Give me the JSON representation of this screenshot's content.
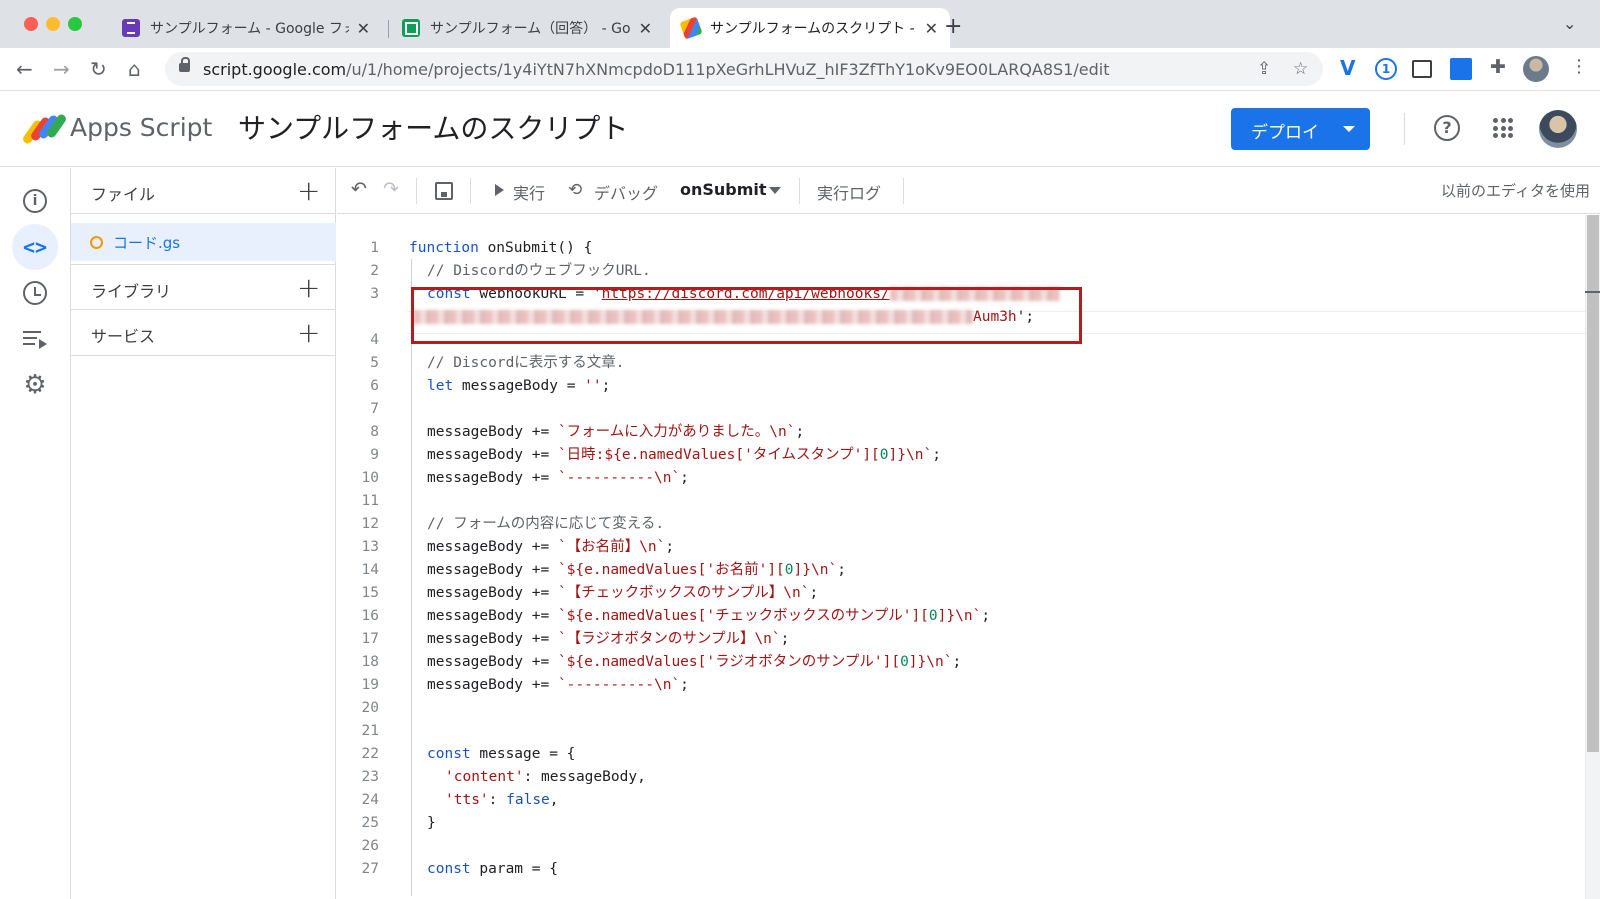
{
  "browser": {
    "tabs": [
      {
        "title": "サンプルフォーム - Google フォーム",
        "icon": "forms-icon",
        "active": false
      },
      {
        "title": "サンプルフォーム（回答） - Google スプレッドシート",
        "icon": "sheets-icon",
        "active": false
      },
      {
        "title": "サンプルフォームのスクリプト - Apps Script",
        "icon": "apps-script-icon",
        "active": true
      }
    ],
    "url_host": "script.google.com",
    "url_path": "/u/1/home/projects/1y4iYtN7hXNmcpdoD111pXeGrhLHVuZ_hIF3ZfThY1oKv9EO0LARQA8S1/edit"
  },
  "header": {
    "brand": "Apps Script",
    "project_title": "サンプルフォームのスクリプト",
    "deploy_label": "デプロイ"
  },
  "files_panel": {
    "files_label": "ファイル",
    "file_name": "コード.gs",
    "libraries_label": "ライブラリ",
    "services_label": "サービス"
  },
  "toolbar": {
    "run_label": "実行",
    "debug_label": "デバッグ",
    "function_name": "onSubmit",
    "log_label": "実行ログ",
    "legacy_editor_label": "以前のエディタを使用"
  },
  "code": {
    "lines": [
      {
        "n": "1"
      },
      {
        "n": "2"
      },
      {
        "n": "3"
      },
      {
        "n": ""
      },
      {
        "n": "4"
      },
      {
        "n": "5"
      },
      {
        "n": "6"
      },
      {
        "n": "7"
      },
      {
        "n": "8"
      },
      {
        "n": "9"
      },
      {
        "n": "10"
      },
      {
        "n": "11"
      },
      {
        "n": "12"
      },
      {
        "n": "13"
      },
      {
        "n": "14"
      },
      {
        "n": "15"
      },
      {
        "n": "16"
      },
      {
        "n": "17"
      },
      {
        "n": "18"
      },
      {
        "n": "19"
      },
      {
        "n": "20"
      },
      {
        "n": "21"
      },
      {
        "n": "22"
      },
      {
        "n": "23"
      },
      {
        "n": "24"
      },
      {
        "n": "25"
      },
      {
        "n": "26"
      },
      {
        "n": "27"
      }
    ],
    "t": {
      "l1_kw": "function",
      "l1_rest": " onSubmit() {",
      "l2": "// DiscordのウェブフックURL.",
      "l3_kw": "const",
      "l3_rest": " webhookURL = '",
      "l3_url": "https://discord.com/api/webhooks/",
      "l3b_tail": "Aum3h",
      "l3b_end": "';",
      "l5": "// Discordに表示する文章.",
      "l6_kw": "let",
      "l6_rest": " messageBody = ",
      "l6_str": "''",
      "l6_end": ";",
      "mb": "messageBody += ",
      "l8_str": "`フォームに入力がありました。\\n`",
      "semi": ";",
      "l9_a": "`日時:${e.namedValues[",
      "l9_b": "'タイムスタンプ'",
      "l9_c": "][",
      "zero": "0",
      "l9_d": "]}\\n`",
      "l10_str": "`----------\\n`",
      "l12": "// フォームの内容に応じて変える.",
      "l13_str": "`【お名前】\\n`",
      "l14_a": "`${e.namedValues[",
      "l14_b": "'お名前'",
      "l14_c": "][",
      "l14_d": "]}\\n`",
      "l15_str": "`【チェックボックスのサンプル】\\n`",
      "l16_b": "'チェックボックスのサンプル'",
      "l17_str": "`【ラジオボタンのサンプル】\\n`",
      "l18_b": "'ラジオボタンのサンプル'",
      "l22_kw": "const",
      "l22_rest": " message = {",
      "l23_str": "'content'",
      "l23_rest": ": messageBody,",
      "l24_str": "'tts'",
      "l24_mid": ": ",
      "l24_kw": "false",
      "l24_end": ",",
      "l25": "}",
      "l27_kw": "const",
      "l27_rest": " param = {"
    }
  }
}
